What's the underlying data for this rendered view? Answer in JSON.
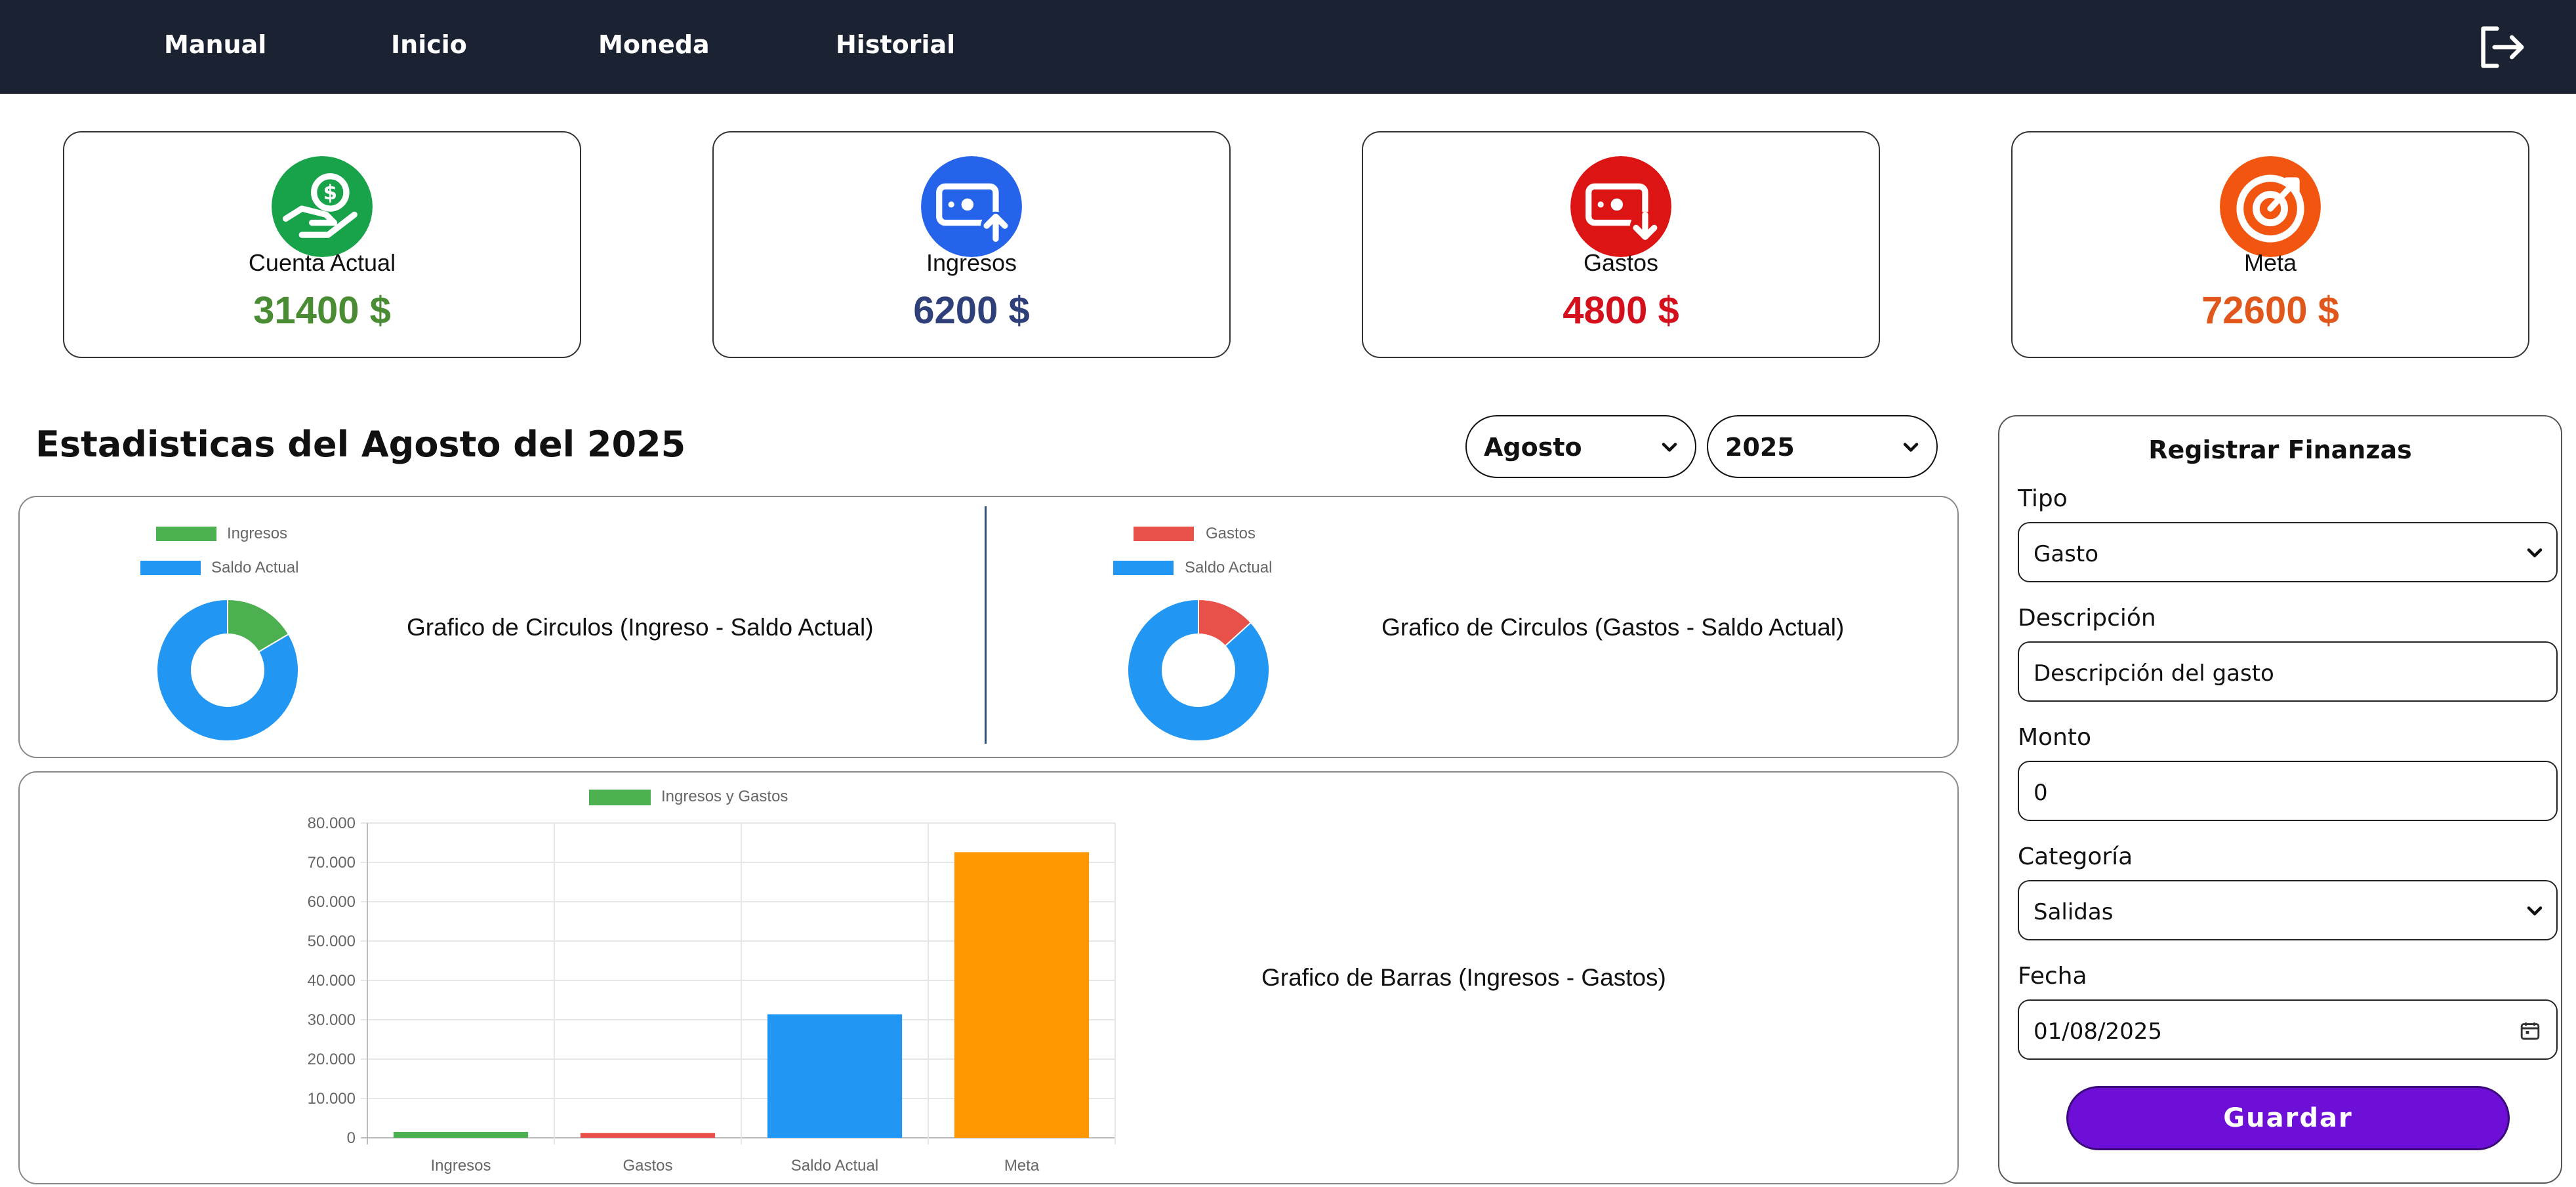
{
  "nav": {
    "items": [
      {
        "label": "Manual"
      },
      {
        "label": "Inicio"
      },
      {
        "label": "Moneda"
      },
      {
        "label": "Historial"
      }
    ],
    "logout_icon": "logout-icon"
  },
  "cards": [
    {
      "icon": "hand-money-icon",
      "label": "Cuenta Actual",
      "value": "31400 $",
      "color": "#4a8c34",
      "icon_bg": "#18a34a"
    },
    {
      "icon": "money-in-icon",
      "label": "Ingresos",
      "value": "6200 $",
      "color": "#2e3f7a",
      "icon_bg": "#2563eb"
    },
    {
      "icon": "money-out-icon",
      "label": "Gastos",
      "value": "4800 $",
      "color": "#d3101c",
      "icon_bg": "#dc1414"
    },
    {
      "icon": "target-icon",
      "label": "Meta",
      "value": "72600 $",
      "color": "#e0561b",
      "icon_bg": "#f2550f"
    }
  ],
  "stats": {
    "title": "Estadisticas del Agosto del 2025",
    "month_select": "Agosto",
    "year_select": "2025"
  },
  "chart_data": [
    {
      "type": "pie",
      "title": "Grafico de Circulos (Ingreso - Saldo Actual)",
      "labels": [
        "Ingresos",
        "Saldo Actual"
      ],
      "values": [
        6200,
        31400
      ],
      "colors": [
        "#4caf50",
        "#2196f3"
      ]
    },
    {
      "type": "pie",
      "title": "Grafico de Circulos (Gastos - Saldo Actual)",
      "labels": [
        "Gastos",
        "Saldo Actual"
      ],
      "values": [
        4800,
        31400
      ],
      "colors": [
        "#e8514a",
        "#2196f3"
      ]
    },
    {
      "type": "bar",
      "title": "Grafico de Barras (Ingresos - Gastos)",
      "legend": "Ingresos y Gastos",
      "categories": [
        "Ingresos",
        "Gastos",
        "Saldo Actual",
        "Meta"
      ],
      "values": [
        1500,
        1200,
        31400,
        72600
      ],
      "colors": [
        "#4caf50",
        "#e8514a",
        "#2196f3",
        "#ff9800"
      ],
      "ylim": [
        0,
        80000
      ],
      "yticks": [
        "80.000",
        "70.000",
        "60.000",
        "50.000",
        "40.000",
        "30.000",
        "20.000",
        "10.000",
        "0"
      ],
      "grid": true,
      "legend_position": "top"
    }
  ],
  "form": {
    "title": "Registrar Finanzas",
    "tipo_label": "Tipo",
    "tipo_value": "Gasto",
    "descripcion_label": "Descripción",
    "descripcion_value": "Descripción del gasto",
    "monto_label": "Monto",
    "monto_value": "0",
    "categoria_label": "Categoría",
    "categoria_value": "Salidas",
    "fecha_label": "Fecha",
    "fecha_value": "01/08/2025",
    "save_label": "Guardar"
  }
}
